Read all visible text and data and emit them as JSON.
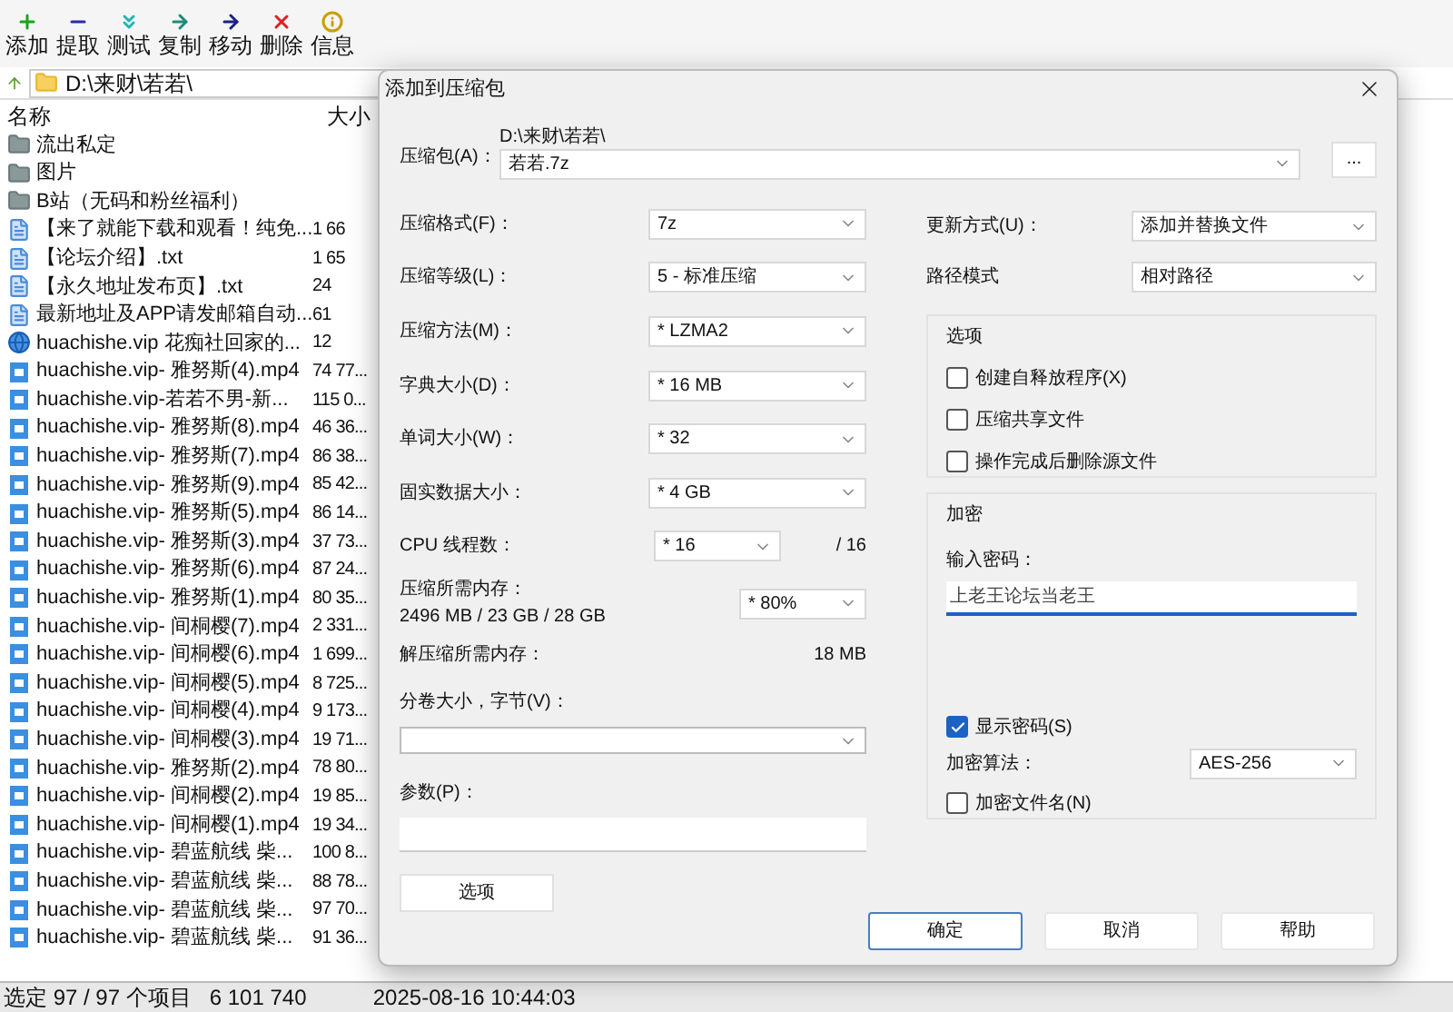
{
  "toolbar": [
    {
      "kind": "add",
      "label": "添加"
    },
    {
      "kind": "extract",
      "label": "提取"
    },
    {
      "kind": "test",
      "label": "测试"
    },
    {
      "kind": "copy",
      "label": "复制"
    },
    {
      "kind": "move",
      "label": "移动"
    },
    {
      "kind": "delete",
      "label": "删除"
    },
    {
      "kind": "info",
      "label": "信息"
    }
  ],
  "path_bar": {
    "path": "D:\\来财\\若若\\"
  },
  "file_list": {
    "columns": [
      "名称",
      "大小"
    ],
    "rows": [
      {
        "kind": "folder",
        "name": "流出私定"
      },
      {
        "kind": "folder",
        "name": "图片"
      },
      {
        "kind": "folder",
        "name": "B站（无码和粉丝福利）"
      },
      {
        "kind": "text",
        "name": "【来了就能下载和观看！纯免...",
        "size": "1 66"
      },
      {
        "kind": "text",
        "name": "【论坛介绍】.txt",
        "size": "1 65"
      },
      {
        "kind": "text",
        "name": "【永久地址发布页】.txt",
        "size": "24"
      },
      {
        "kind": "text",
        "name": "最新地址及APP请发邮箱自动...",
        "size": "61"
      },
      {
        "kind": "web",
        "name": "huachishe.vip 花痴社回家的...",
        "size": "12"
      },
      {
        "kind": "video",
        "name": "huachishe.vip- 雅努斯(4).mp4",
        "size": "74 77..."
      },
      {
        "kind": "video",
        "name": "huachishe.vip-若若不男-新...",
        "size": "115 0..."
      },
      {
        "kind": "video",
        "name": "huachishe.vip- 雅努斯(8).mp4",
        "size": "46 36..."
      },
      {
        "kind": "video",
        "name": "huachishe.vip- 雅努斯(7).mp4",
        "size": "86 38..."
      },
      {
        "kind": "video",
        "name": "huachishe.vip- 雅努斯(9).mp4",
        "size": "85 42..."
      },
      {
        "kind": "video",
        "name": "huachishe.vip- 雅努斯(5).mp4",
        "size": "86 14..."
      },
      {
        "kind": "video",
        "name": "huachishe.vip- 雅努斯(3).mp4",
        "size": "37 73..."
      },
      {
        "kind": "video",
        "name": "huachishe.vip- 雅努斯(6).mp4",
        "size": "87 24..."
      },
      {
        "kind": "video",
        "name": "huachishe.vip- 雅努斯(1).mp4",
        "size": "80 35..."
      },
      {
        "kind": "video",
        "name": "huachishe.vip- 间桐樱(7).mp4",
        "size": "2 331..."
      },
      {
        "kind": "video",
        "name": "huachishe.vip- 间桐樱(6).mp4",
        "size": "1 699..."
      },
      {
        "kind": "video",
        "name": "huachishe.vip- 间桐樱(5).mp4",
        "size": "8 725..."
      },
      {
        "kind": "video",
        "name": "huachishe.vip- 间桐樱(4).mp4",
        "size": "9 173..."
      },
      {
        "kind": "video",
        "name": "huachishe.vip- 间桐樱(3).mp4",
        "size": "19 71..."
      },
      {
        "kind": "video",
        "name": "huachishe.vip- 雅努斯(2).mp4",
        "size": "78 80..."
      },
      {
        "kind": "video",
        "name": "huachishe.vip- 间桐樱(2).mp4",
        "size": "19 85..."
      },
      {
        "kind": "video",
        "name": "huachishe.vip- 间桐樱(1).mp4",
        "size": "19 34..."
      },
      {
        "kind": "video",
        "name": "huachishe.vip- 碧蓝航线 柴...",
        "size": "100 8..."
      },
      {
        "kind": "video",
        "name": "huachishe.vip- 碧蓝航线 柴...",
        "size": "88 78..."
      },
      {
        "kind": "video",
        "name": "huachishe.vip- 碧蓝航线 柴...",
        "size": "97 70..."
      },
      {
        "kind": "video",
        "name": "huachishe.vip- 碧蓝航线 柴...",
        "size": "91 36..."
      }
    ]
  },
  "status_bar": {
    "selection": "选定 97 / 97 个项目",
    "size": "6 101 740",
    "date": "2025-08-16 10:44:03"
  },
  "dialog": {
    "title": "添加到压缩包",
    "archive": {
      "label": "压缩包(A)：",
      "folder": "D:\\来财\\若若\\",
      "value": "若若.7z",
      "browse": "..."
    },
    "left_fields": [
      {
        "label": "压缩格式(F)：",
        "value": "7z"
      },
      {
        "label": "压缩等级(L)：",
        "value": "5 - 标准压缩"
      },
      {
        "label": "压缩方法(M)：",
        "value": "*  LZMA2"
      },
      {
        "label": "字典大小(D)：",
        "value": "*  16 MB"
      },
      {
        "label": "单词大小(W)：",
        "value": "*  32"
      },
      {
        "label": "固实数据大小：",
        "value": "*  4 GB"
      }
    ],
    "cpu": {
      "label": "CPU 线程数：",
      "value": "*  16",
      "max": "/ 16"
    },
    "memory": {
      "label": "压缩所需内存：",
      "value": "2496 MB / 23 GB / 28 GB",
      "limit": "* 80%"
    },
    "decompress": {
      "label": "解压缩所需内存：",
      "value": "18 MB"
    },
    "volume": {
      "label": "分卷大小，字节(V)："
    },
    "params": {
      "label": "参数(P)："
    },
    "options_button": "选项",
    "right_fields": [
      {
        "label": "更新方式(U)：",
        "value": "添加并替换文件"
      },
      {
        "label": "路径模式",
        "value": "相对路径"
      }
    ],
    "options_group": {
      "title": "选项",
      "items": [
        {
          "label": "创建自释放程序(X)",
          "checked": false
        },
        {
          "label": "压缩共享文件",
          "checked": false
        },
        {
          "label": "操作完成后删除源文件",
          "checked": false
        }
      ]
    },
    "encryption": {
      "title": "加密",
      "password_label": "输入密码：",
      "password": "上老王论坛当老王",
      "show_password": {
        "label": "显示密码(S)",
        "checked": true
      },
      "method_label": "加密算法：",
      "method": "AES-256",
      "encrypt_names": {
        "label": "加密文件名(N)",
        "checked": false
      }
    },
    "buttons": [
      {
        "label": "确定",
        "focused": true
      },
      {
        "label": "取消",
        "focused": false
      },
      {
        "label": "帮助",
        "focused": false
      }
    ]
  }
}
